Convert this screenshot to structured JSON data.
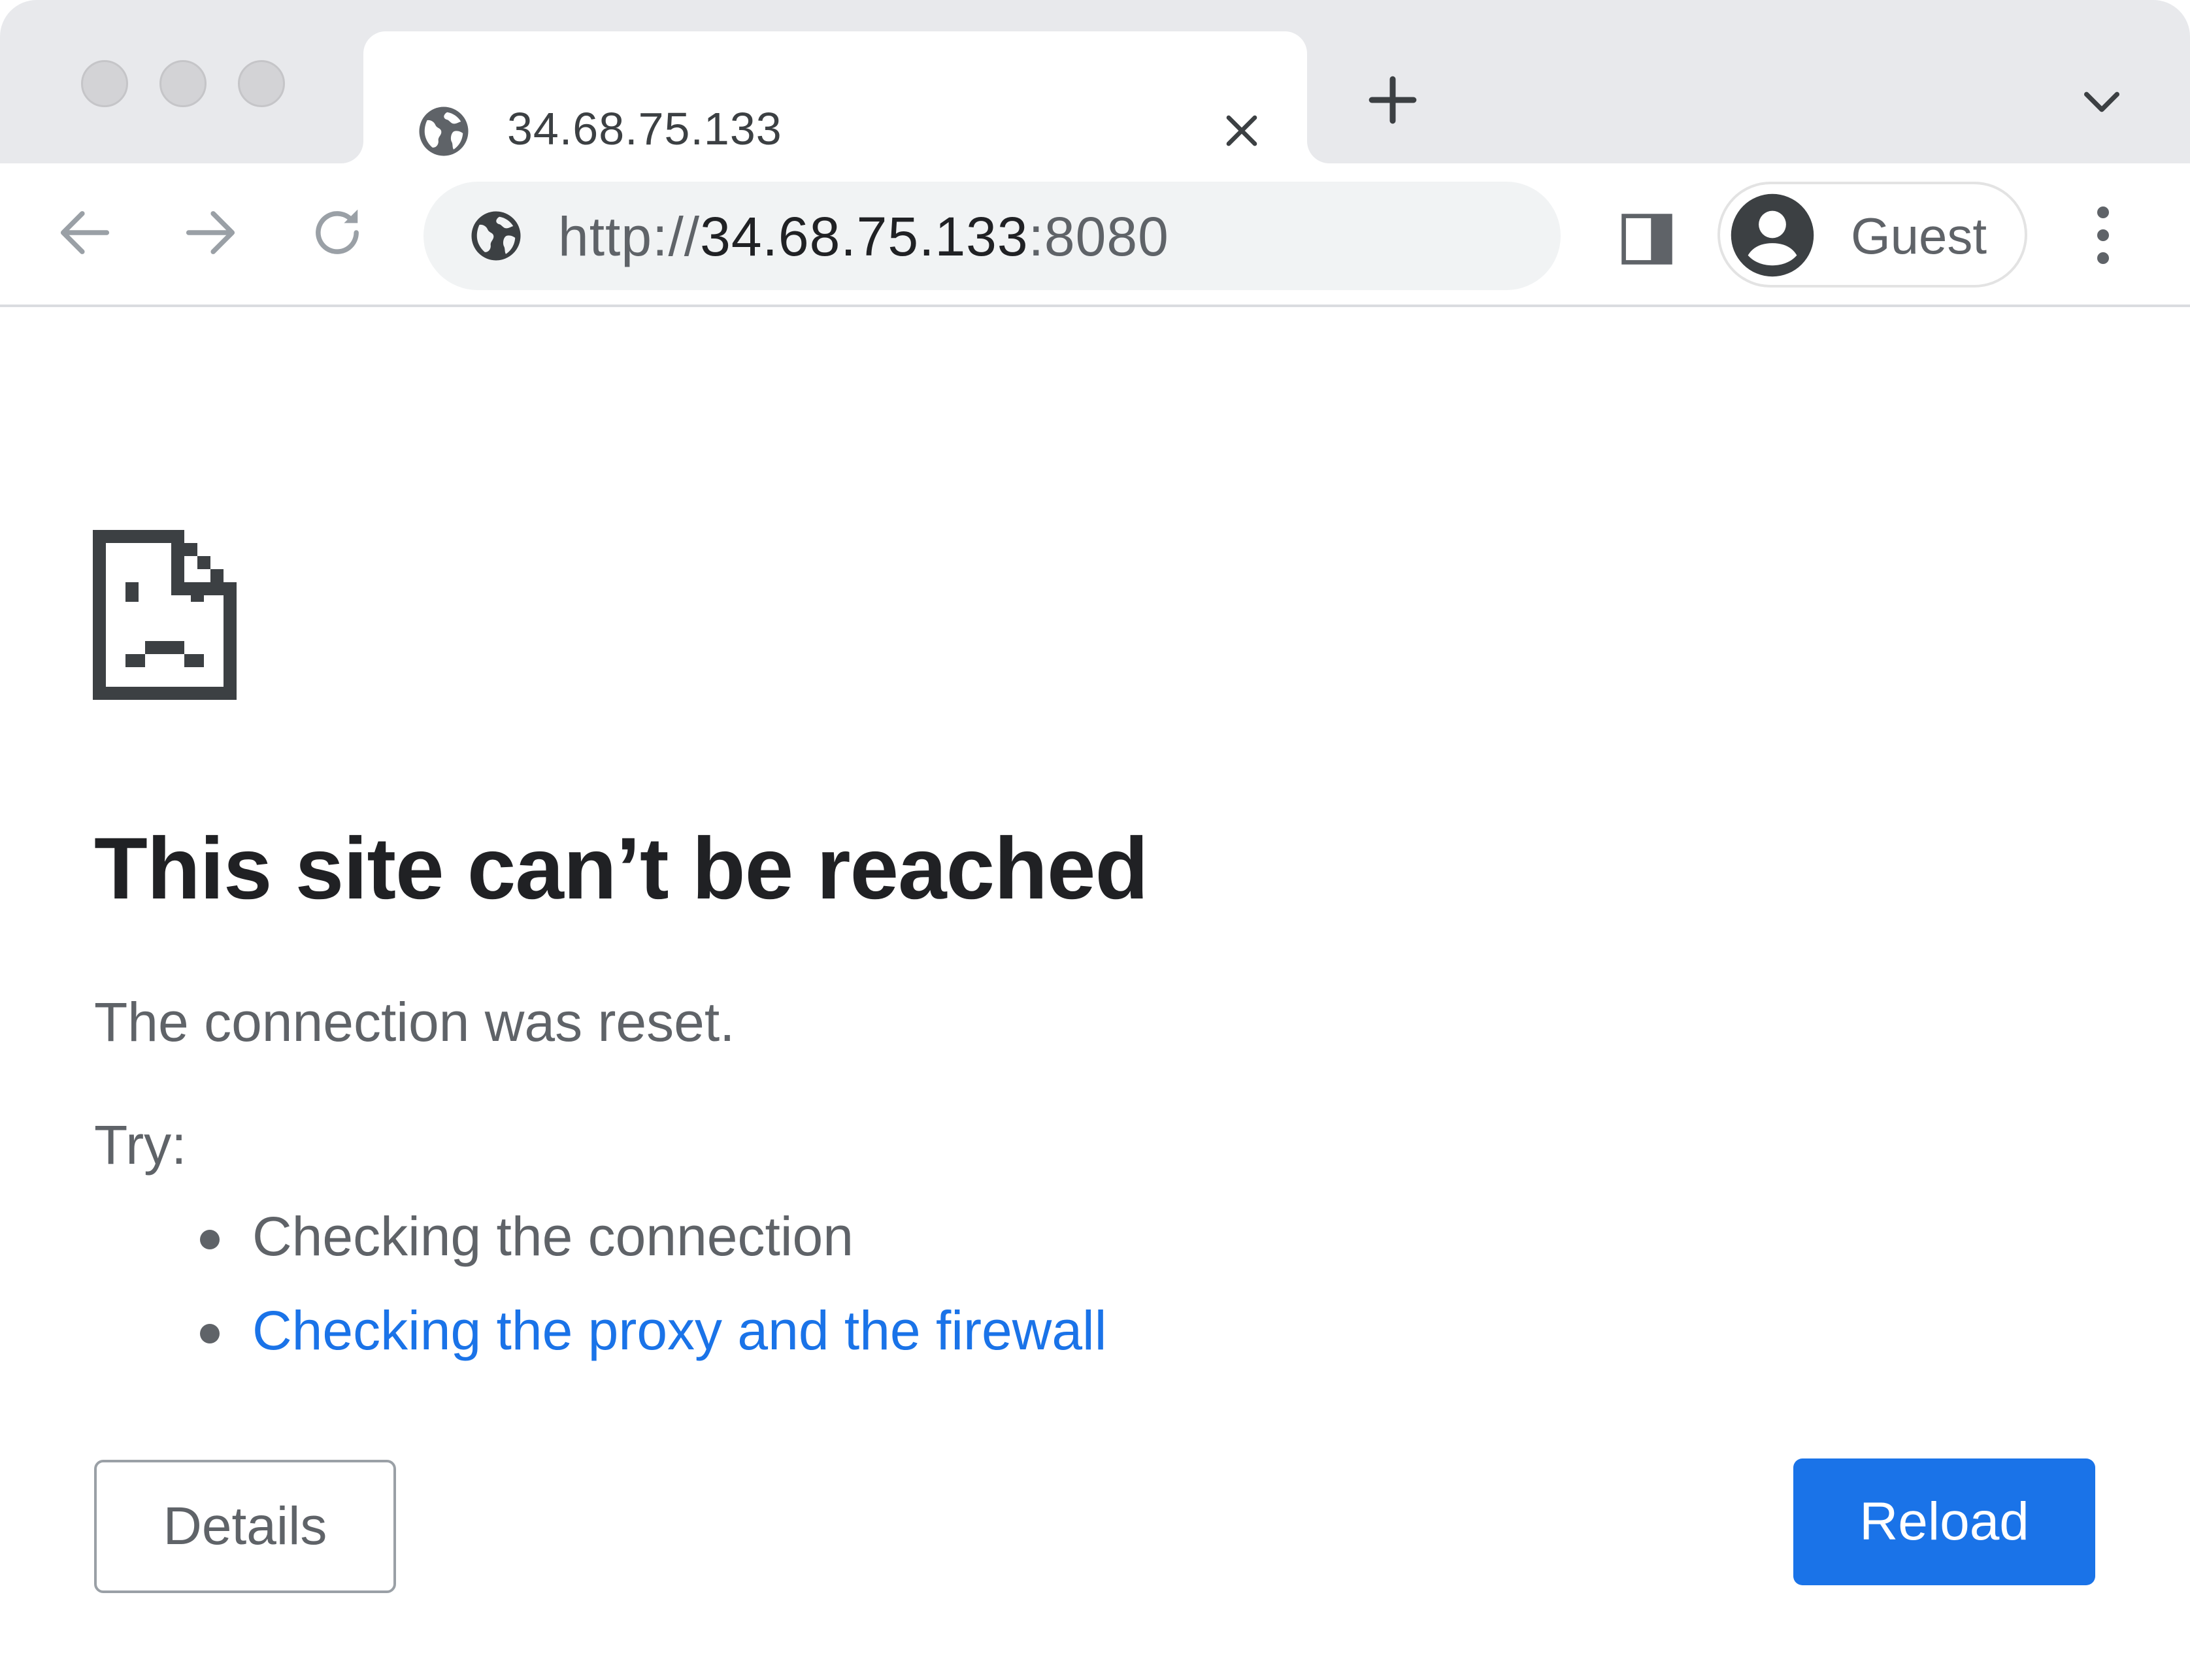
{
  "window": {
    "traffic_lights": [
      "close",
      "minimize",
      "zoom"
    ]
  },
  "tab": {
    "title": "34.68.75.133",
    "favicon": "globe-icon",
    "close_icon": "close-icon"
  },
  "tabstrip": {
    "new_tab_icon": "plus-icon",
    "tab_search_icon": "chevron-down-icon"
  },
  "toolbar": {
    "back_icon": "arrow-left-icon",
    "forward_icon": "arrow-right-icon",
    "reload_icon": "reload-icon",
    "url_scheme": "http://",
    "url_host": "34.68.75.133",
    "url_port": ":8080",
    "site_info_icon": "globe-icon",
    "side_panel_icon": "side-panel-icon",
    "profile_label": "Guest",
    "profile_icon": "avatar-icon",
    "menu_icon": "kebab-menu-icon"
  },
  "error_page": {
    "icon": "sad-document-icon",
    "title": "This site can’t be reached",
    "message": "The connection was reset.",
    "try_label": "Try:",
    "suggestions": [
      "Checking the connection",
      "Checking the proxy and the firewall"
    ],
    "details_button": "Details",
    "reload_button": "Reload"
  },
  "colors": {
    "accent": "#1a73e8",
    "text_primary": "#202124",
    "text_secondary": "#5f6368",
    "tabstrip_bg": "#e8e9ec",
    "omnibox_bg": "#f1f3f4"
  }
}
